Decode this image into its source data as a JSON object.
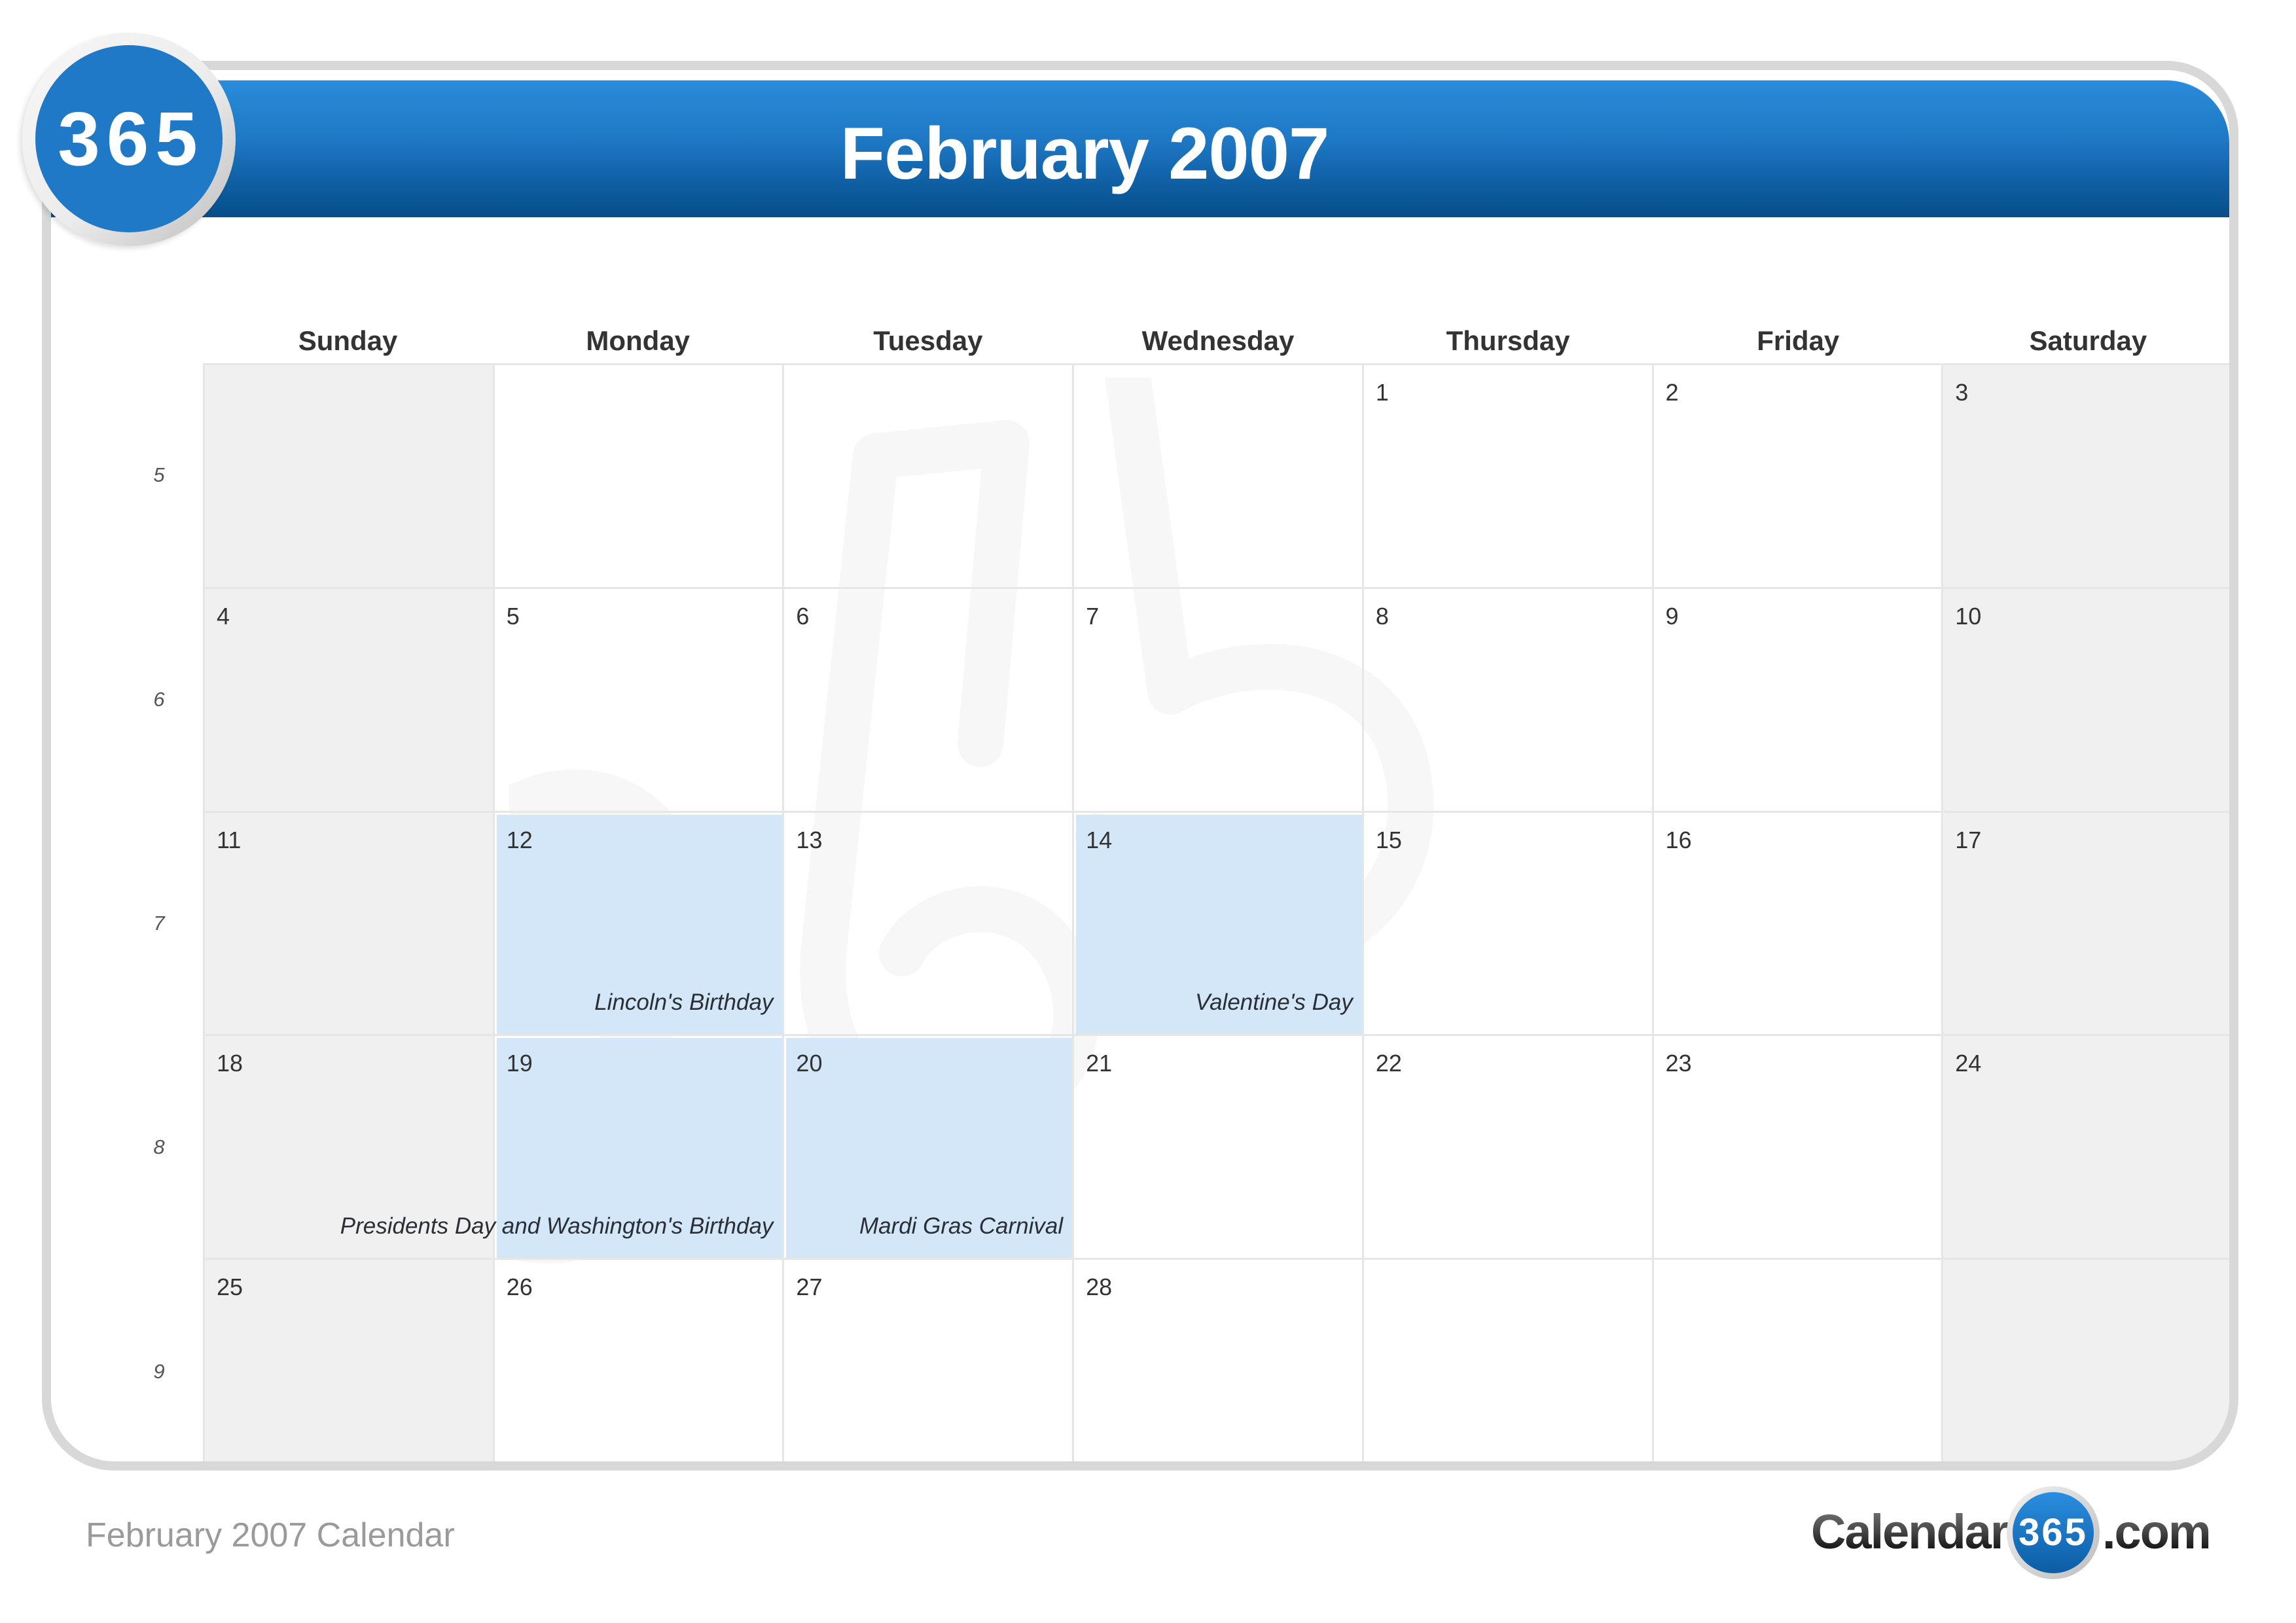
{
  "header": {
    "badge_text": "365",
    "title": "February 2007"
  },
  "colors": {
    "header_blue_top": "#2a8cdb",
    "header_blue_bottom": "#064e89",
    "badge_blue": "#2079c7",
    "holiday_highlight": "#d3e7f9",
    "weekend_fill": "#f0f0f0",
    "frame_gray": "#d8d8d8"
  },
  "weekdays": [
    "Sunday",
    "Monday",
    "Tuesday",
    "Wednesday",
    "Thursday",
    "Friday",
    "Saturday"
  ],
  "week_numbers": [
    "5",
    "6",
    "7",
    "8",
    "9"
  ],
  "weeks": [
    [
      {
        "day": "",
        "weekend": true
      },
      {
        "day": ""
      },
      {
        "day": ""
      },
      {
        "day": ""
      },
      {
        "day": "1"
      },
      {
        "day": "2"
      },
      {
        "day": "3",
        "weekend": true
      }
    ],
    [
      {
        "day": "4",
        "weekend": true
      },
      {
        "day": "5"
      },
      {
        "day": "6"
      },
      {
        "day": "7"
      },
      {
        "day": "8"
      },
      {
        "day": "9"
      },
      {
        "day": "10",
        "weekend": true
      }
    ],
    [
      {
        "day": "11",
        "weekend": true
      },
      {
        "day": "12",
        "highlight": true,
        "event": "Lincoln's Birthday"
      },
      {
        "day": "13"
      },
      {
        "day": "14",
        "highlight": true,
        "event": "Valentine's Day"
      },
      {
        "day": "15"
      },
      {
        "day": "16"
      },
      {
        "day": "17",
        "weekend": true
      }
    ],
    [
      {
        "day": "18",
        "weekend": true
      },
      {
        "day": "19",
        "highlight": true,
        "event": "Presidents Day and Washington's Birthday"
      },
      {
        "day": "20",
        "highlight": true,
        "event": "Mardi Gras Carnival"
      },
      {
        "day": "21"
      },
      {
        "day": "22"
      },
      {
        "day": "23"
      },
      {
        "day": "24",
        "weekend": true
      }
    ],
    [
      {
        "day": "25",
        "weekend": true
      },
      {
        "day": "26"
      },
      {
        "day": "27"
      },
      {
        "day": "28"
      },
      {
        "day": ""
      },
      {
        "day": ""
      },
      {
        "day": "",
        "weekend": true
      }
    ]
  ],
  "watermark_text": "365",
  "footer": {
    "caption": "February 2007 Calendar",
    "logo_left": "Calendar-",
    "logo_badge": "365",
    "logo_right": ".com"
  }
}
